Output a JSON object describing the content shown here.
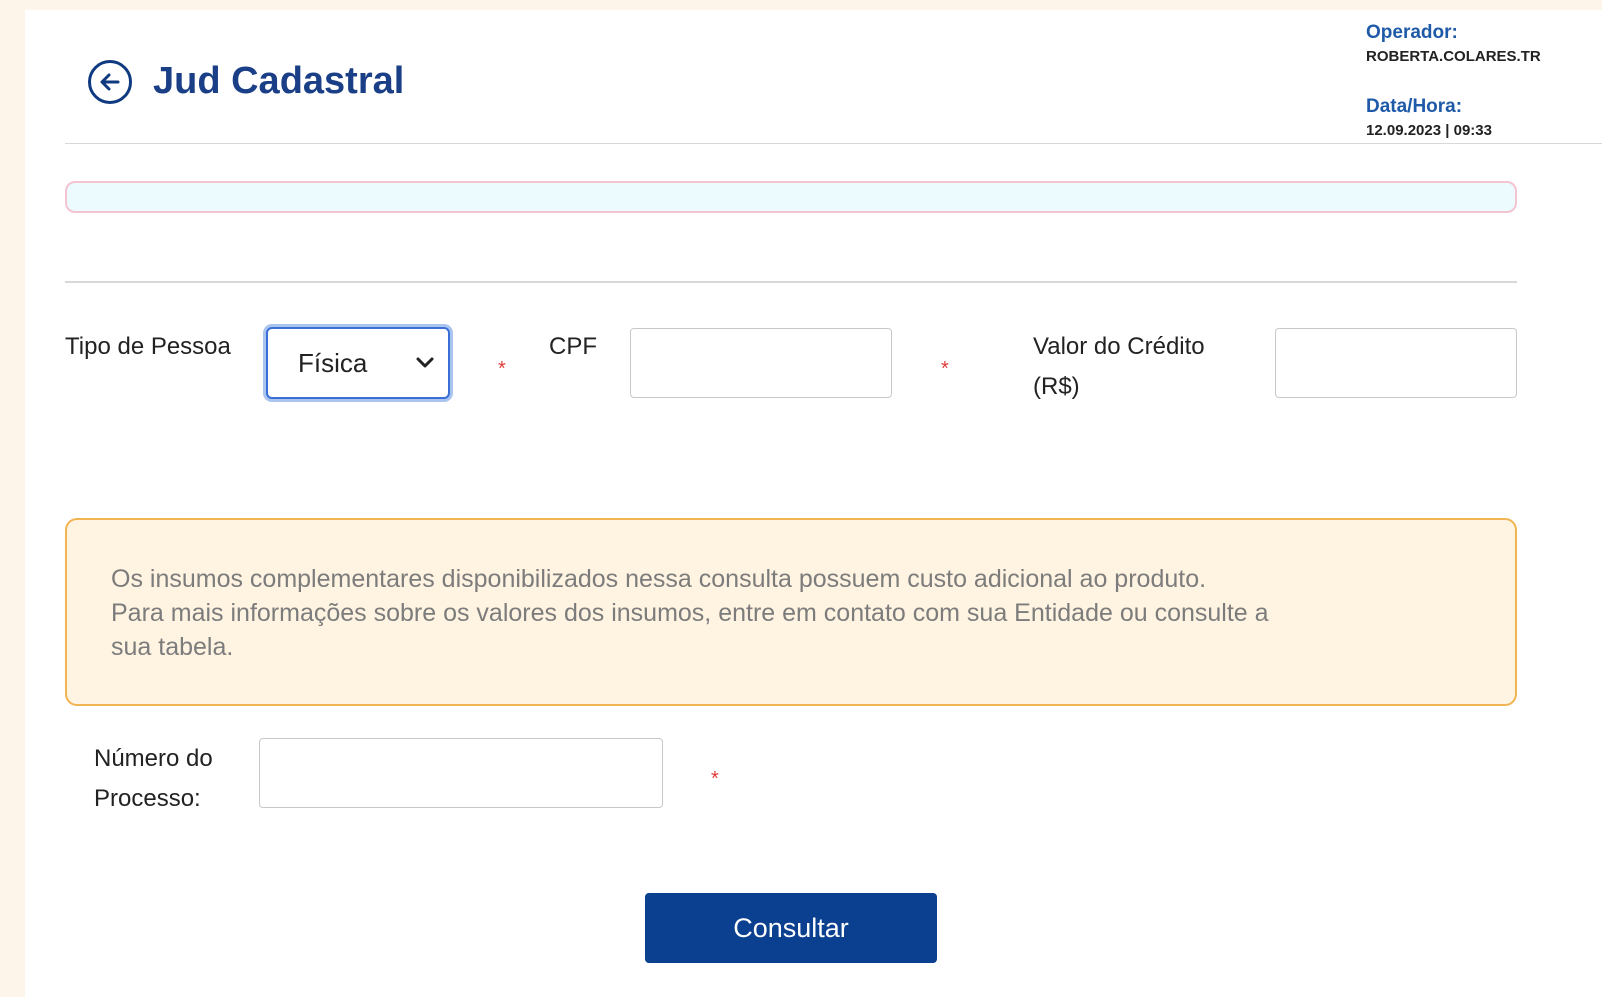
{
  "header": {
    "title": "Jud Cadastral",
    "operator_label": "Operador:",
    "operator_value": "ROBERTA.COLARES.TR",
    "datetime_label": "Data/Hora:",
    "datetime_value": "12.09.2023 | 09:33"
  },
  "form": {
    "tipo_pessoa_label": "Tipo de Pessoa",
    "tipo_pessoa_value": "Física",
    "cpf_label": "CPF",
    "cpf_value": "",
    "valor_label_line1": "Valor do Crédito",
    "valor_label_line2": "(R$)",
    "valor_value": "",
    "processo_label_line1": "Número do",
    "processo_label_line2": "Processo:",
    "processo_value": "",
    "required_mark": "*"
  },
  "notice": {
    "line1": "Os insumos complementares disponibilizados nessa consulta possuem custo adicional ao produto.",
    "line2": "Para mais informações sobre os valores dos insumos, entre em contato com sua Entidade ou consulte a",
    "line3": "sua tabela."
  },
  "actions": {
    "consult_label": "Consultar"
  },
  "icons": {
    "back": "arrow-left-circle-icon",
    "select_chevron": "chevron-down-icon"
  },
  "colors": {
    "primary": "#0b3f8f",
    "title": "#1a3f87",
    "required": "#e23b3b",
    "notice_border": "#f1b452"
  }
}
